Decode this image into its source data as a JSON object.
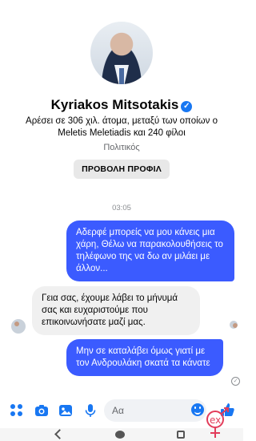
{
  "profile": {
    "name": "Kyriakos Mitsotakis",
    "verified_icon": "verified-check",
    "likes": "Αρέσει σε 306 χιλ. άτομα, μεταξύ των οποίων ο Meletis Meletiadis και 240 φίλοι",
    "category": "Πολιτικός",
    "view_profile_label": "ΠΡΟΒΟΛΗ ΠΡΟΦΙΛ"
  },
  "conversation": {
    "timestamp": "03:05",
    "messages": [
      {
        "direction": "outgoing",
        "text": "Αδερφέ μπορείς να μου κάνεις μια χάρη, Θέλω να παρακολουθήσεις το τηλέφωνο της να δω αν μιλάει με άλλον..."
      },
      {
        "direction": "incoming",
        "text": "Γεια σας, έχουμε λάβει το μήνυμά σας και ευχαριστούμε που επικοινωνήσατε μαζί μας."
      },
      {
        "direction": "outgoing",
        "text": "Μην σε καταλάβει όμως γιατί με τον Ανδρουλάκη σκατά τα κάνατε"
      }
    ]
  },
  "composer": {
    "placeholder": "Αα",
    "icons": [
      "apps-grid-icon",
      "camera-icon",
      "image-icon",
      "microphone-icon",
      "emoji-icon",
      "thumbs-up-icon"
    ]
  },
  "colors": {
    "outgoing_bubble": "#3b5bff",
    "incoming_bubble": "#f0f0f0",
    "messenger_blue": "#1877f2",
    "watermark": "#e23c5a"
  }
}
